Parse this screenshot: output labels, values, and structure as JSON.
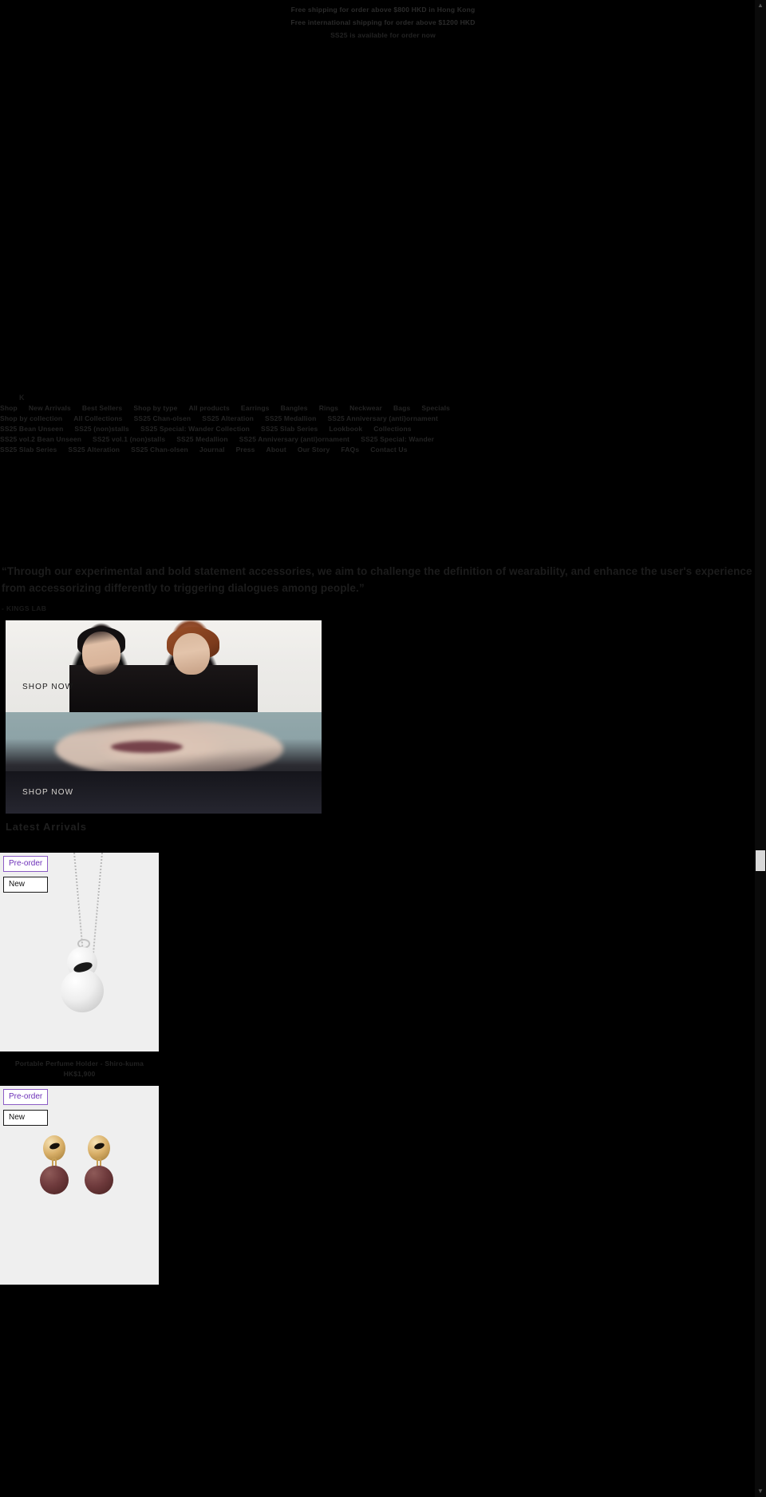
{
  "announcement": {
    "lines": [
      "Free shipping for order above $800 HKD in Hong Kong",
      "Free international shipping for order above $1200 HKD",
      "SS25 is available for order now"
    ]
  },
  "header": {
    "logo": "K"
  },
  "nav": {
    "rows": [
      [
        {
          "label": "Shop"
        },
        {
          "label": "New Arrivals"
        },
        {
          "label": "Best Sellers"
        },
        {
          "label": "Shop by type"
        },
        {
          "label": "All products"
        },
        {
          "label": "Earrings"
        },
        {
          "label": "Bangles"
        },
        {
          "label": "Rings"
        },
        {
          "label": "Neckwear"
        },
        {
          "label": "Bags"
        },
        {
          "label": "Specials"
        }
      ],
      [
        {
          "label": "Shop by collection"
        },
        {
          "label": "All Collections"
        },
        {
          "label": "SS25 Chan-olsen"
        },
        {
          "label": "SS25 Alteration"
        },
        {
          "label": "SS25 Medallion"
        },
        {
          "label": "SS25 Anniversary (anti)ornament"
        }
      ],
      [
        {
          "label": "SS25 Bean Unseen"
        },
        {
          "label": "SS25 (non)stalls"
        },
        {
          "label": "SS25 Special: Wander Collection"
        },
        {
          "label": "SS25 Slab Series"
        },
        {
          "label": "Lookbook"
        },
        {
          "label": "Collections"
        }
      ],
      [
        {
          "label": "SS25 vol.2 Bean Unseen"
        },
        {
          "label": "SS25 vol.1 (non)stalls"
        },
        {
          "label": "SS25 Medallion"
        },
        {
          "label": "SS25 Anniversary (anti)ornament"
        },
        {
          "label": "SS25 Special: Wander"
        }
      ],
      [
        {
          "label": "SS25 Slab Series"
        },
        {
          "label": "SS25 Alteration"
        },
        {
          "label": "SS25 Chan-olsen"
        },
        {
          "label": "Journal"
        },
        {
          "label": "Press"
        },
        {
          "label": "About"
        },
        {
          "label": "Our Story"
        },
        {
          "label": "FAQs"
        },
        {
          "label": "Contact Us"
        }
      ]
    ]
  },
  "hero": {
    "quote": "“Through our experimental and bold statement accessories, we aim to challenge the definition of wearability, and enhance the user's experience - from accessorizing differently to triggering dialogues among people.”",
    "attribution": "- KINGS LAB",
    "slide_one": {
      "cta": "SHOP NOW",
      "alt": "two models wearing statement gold jewellery"
    },
    "slide_two": {
      "cta": "SHOP NOW",
      "alt": "blurred portrait with earring"
    }
  },
  "section": {
    "heading": "Latest Arrivals"
  },
  "products": [
    {
      "badges": [
        "Pre-order",
        "New"
      ],
      "title": "Portable Perfume Holder - Shiro-kuma",
      "price": "HK$1,900",
      "alt": "white perfume holder pendant on silver chain"
    },
    {
      "badges": [
        "Pre-order",
        "New"
      ],
      "title": "",
      "price": "",
      "alt": "gold and maroon drop earrings"
    }
  ],
  "scrollbar": {
    "up_glyph": "▲",
    "down_glyph": "▼"
  },
  "colors": {
    "background": "#000000",
    "preorder_accent": "#8b5cc4",
    "card_background": "#efefef",
    "muted_text": "#242424"
  }
}
